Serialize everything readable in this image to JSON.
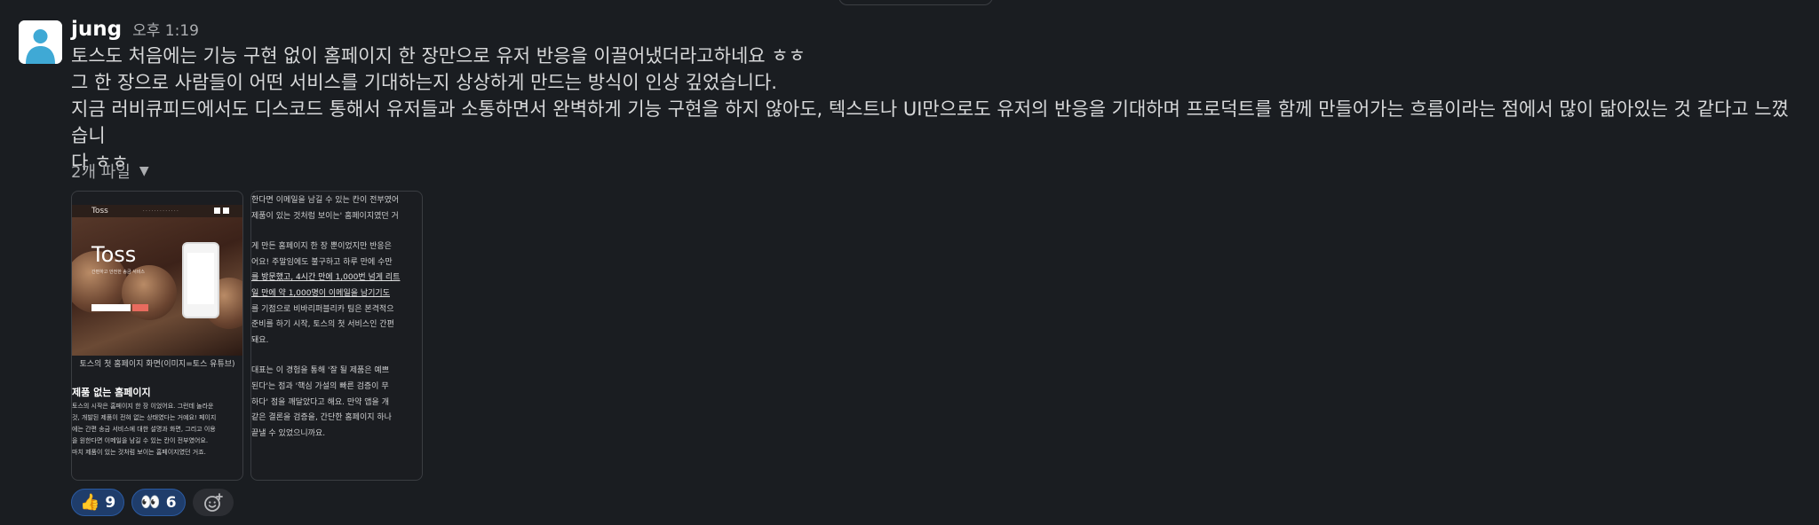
{
  "message": {
    "author": "jung",
    "timestamp": "오후 1:19",
    "lines": [
      "토스도 처음에는 기능 구현 없이 홈페이지 한 장만으로 유저 반응을 이끌어냈더라고하네요 ㅎㅎ",
      "그 한 장으로 사람들이 어떤 서비스를 기대하는지 상상하게 만드는 방식이 인상 깊었습니다.",
      "지금 러비큐피드에서도 디스코드 통해서 유저들과 소통하면서 완벽하게 기능 구현을 하지 않아도, 텍스트나 UI만으로도 유저의 반응을 기대하며 프로덕트를 함께 만들어가는 흐름이라는 점에서 많이 닮아있는 것 같다고 느꼈습니",
      "다 ㅎㅎ"
    ]
  },
  "files": {
    "toggle_label": "2개 파일",
    "thumb1": {
      "site_logo": "Toss",
      "hero_title": "Toss",
      "hero_subtitle": "간편하고 안전한 송금 서비스",
      "caption": "토스의 첫 홈페이지 화면(이미지=토스 유튜브)",
      "heading": "제품 없는 홈페이지",
      "lines": [
        "토스의 시작은 홈페이지 한 장 이었어요. 그런데 놀라운",
        "것, 개발된 제품이 전혀 없는 상태였다는 거예요! 페이지",
        "에는 간편 송금 서비스에 대한 설명과 화면, 그리고 이용",
        "을 원한다면 이메일을 남길 수 있는 칸이 전부였어요.",
        "마치 제품이 있는 것처럼 보이는 홈페이지였던 거죠."
      ]
    },
    "thumb2": {
      "lines": [
        "한다면 이메일을 남길 수 있는 칸이 전부였어",
        "제품이 있는 것처럼 보이는' 홈페이지였던 거",
        "",
        "게 만든 홈페이지 한 장 뿐이었지만 반응은",
        "어요! 주말임에도 불구하고 하루 만에 수만",
        "를 방문했고, 4시간 만에 1,000번 넘게 리트",
        "일 만에 약 1,000명이 이메일을 남기기도",
        "를 기점으로 비바리퍼블리카 팀은 본격적으",
        "준비를 하기 시작, 토스의 첫 서비스인 간편",
        "돼요.",
        "",
        "대표는 이 경험을 통해 '잘 될 제품은 예쁘",
        "된다'는 점과 '핵심 가설의 빠른 검증이 무",
        "하다' 점을 깨달았다고 해요. 만약 앱을 개",
        "같은 결론을 검증을, 간단한 홈페이지 하나",
        "끝낼 수 있었으니까요."
      ]
    }
  },
  "reactions": [
    {
      "emoji": "👍",
      "count": "9",
      "icon": "thumbs-up-icon"
    },
    {
      "emoji": "👀",
      "count": "6",
      "icon": "eyes-icon"
    }
  ],
  "colors": {
    "background": "#1a1d21",
    "reaction_bg": "#1f3d6b",
    "reaction_border": "#2b5aa0",
    "avatar_blue": "#3fa9d5"
  }
}
